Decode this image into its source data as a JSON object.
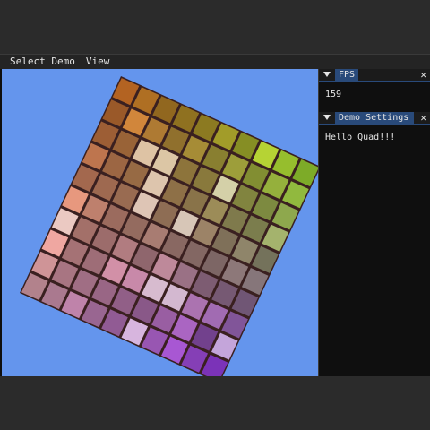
{
  "menubar": {
    "items": [
      "Select Demo",
      "View"
    ]
  },
  "fps_panel": {
    "title": "FPS",
    "value": "159",
    "arrow_icon": "triangle-down-icon",
    "close_icon": "close-icon"
  },
  "settings_panel": {
    "title": "Demo Settings",
    "message": "Hello Quad!!!",
    "arrow_icon": "triangle-down-icon",
    "close_icon": "close-icon"
  },
  "scene": {
    "background_color": "#6495ed",
    "grid_size": 10,
    "corner_colors": {
      "top_left": "#d2691e",
      "top_right": "#adff2f",
      "bottom_left": "#ffc0cb",
      "bottom_right": "#8a2be2"
    }
  },
  "theme": {
    "window_bg": "#0f0f0f",
    "menubar_bg": "#242424",
    "tab_active": "#294a7a",
    "text": "#e6e6e6"
  }
}
